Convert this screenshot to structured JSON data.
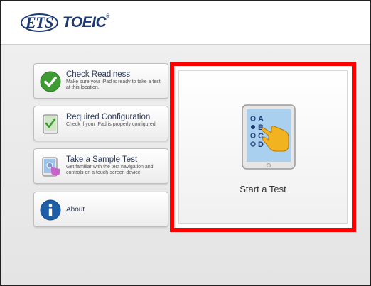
{
  "header": {
    "logo_ets": "ETS",
    "logo_toeic": "TOEIC",
    "logo_mark": "®"
  },
  "menu": [
    {
      "title": "Check Readiness",
      "desc": "Make sure your iPad is ready to take a test at this location.",
      "icon": "check-circle-icon"
    },
    {
      "title": "Required Configuration",
      "desc": "Check if your iPad is properly configured.",
      "icon": "ipad-check-icon"
    },
    {
      "title": "Take a Sample Test",
      "desc": "Get familiar with the test navigation and controls on a touch-screen device.",
      "icon": "ipad-touch-icon"
    },
    {
      "title": "About",
      "icon": "info-icon"
    }
  ],
  "start": {
    "label": "Start a Test",
    "options": [
      "A",
      "B",
      "C",
      "D"
    ],
    "selected_option": "B"
  },
  "colors": {
    "highlight": "#ff0000",
    "brand": "#1e3a73",
    "check_green": "#3f9c35",
    "info_blue": "#1f5fa8"
  }
}
